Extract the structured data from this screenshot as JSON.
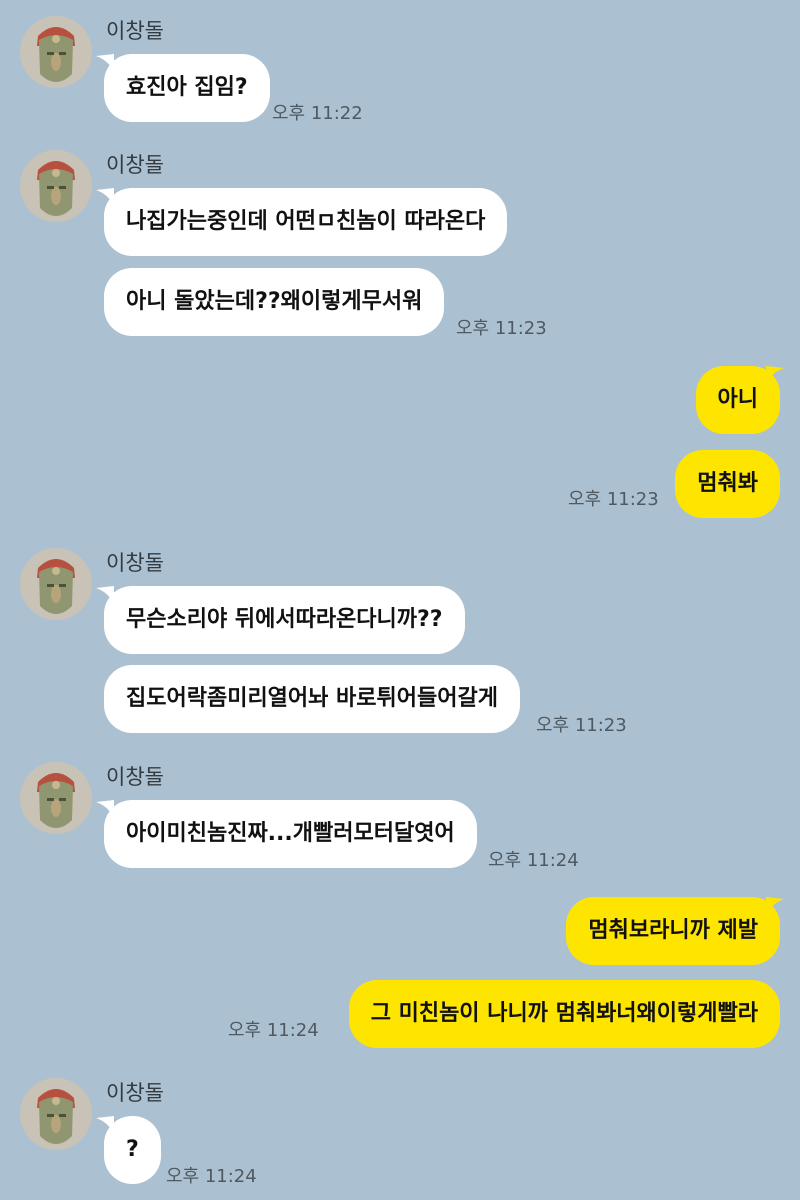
{
  "chat": {
    "contact_name": "이창돌",
    "groups": [
      {
        "sender": "이창돌",
        "messages": [
          "효진아 집임?"
        ],
        "time": "오후 11:22"
      },
      {
        "sender": "이창돌",
        "messages": [
          "나집가는중인데 어떤ㅁ친놈이 따라온다",
          "아니 돌았는데??왜이렇게무서워"
        ],
        "time": "오후 11:23"
      },
      {
        "sender": "me",
        "messages": [
          "아니",
          "멈춰봐"
        ],
        "time": "오후 11:23"
      },
      {
        "sender": "이창돌",
        "messages": [
          "무슨소리야 뒤에서따라온다니까??",
          "집도어락좀미리열어놔 바로튀어들어갈게"
        ],
        "time": "오후 11:23"
      },
      {
        "sender": "이창돌",
        "messages": [
          "아이미친놈진짜...개빨러모터달엿어"
        ],
        "time": "오후 11:24"
      },
      {
        "sender": "me",
        "messages": [
          "멈춰보라니까 제발",
          "그 미친놈이 나니까 멈춰봐너왜이렇게빨라"
        ],
        "time": "오후 11:24"
      },
      {
        "sender": "이창돌",
        "messages": [
          "?"
        ],
        "time": "오후 11:24"
      }
    ]
  },
  "colors": {
    "background": "#abc1d1",
    "incoming_bubble": "#ffffff",
    "outgoing_bubble": "#fee500"
  },
  "icons": {
    "avatar": "profile-avatar-icon",
    "bubble_tail": "bubble-tail-icon"
  }
}
